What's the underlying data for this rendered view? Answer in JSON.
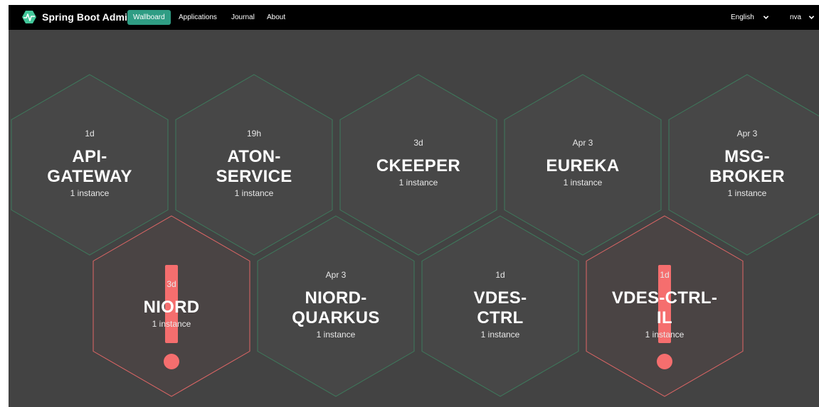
{
  "brand": {
    "title": "Spring Boot Admin"
  },
  "nav": {
    "items": [
      {
        "label": "Wallboard",
        "active": true
      },
      {
        "label": "Applications",
        "active": false
      },
      {
        "label": "Journal",
        "active": false
      },
      {
        "label": "About",
        "active": false
      }
    ],
    "language": "English",
    "user": "nva"
  },
  "colors": {
    "background": "#434343",
    "navbar": "#000000",
    "accent": "#2f9d84",
    "hex_up_border": "#3e7a5c",
    "hex_down_border": "#e06666",
    "hex_fill": "#474747",
    "down_indicator": "#f56e6e"
  },
  "applications": [
    {
      "time": "1d",
      "name_lines": [
        "API-",
        "GATEWAY"
      ],
      "instances": "1 instance",
      "status": "up"
    },
    {
      "time": "19h",
      "name_lines": [
        "ATON-",
        "SERVICE"
      ],
      "instances": "1 instance",
      "status": "up"
    },
    {
      "time": "3d",
      "name_lines": [
        "CKEEPER"
      ],
      "instances": "1 instance",
      "status": "up"
    },
    {
      "time": "Apr 3",
      "name_lines": [
        "EUREKA"
      ],
      "instances": "1 instance",
      "status": "up"
    },
    {
      "time": "Apr 3",
      "name_lines": [
        "MSG-",
        "BROKER"
      ],
      "instances": "1 instance",
      "status": "up"
    },
    {
      "time": "3d",
      "name_lines": [
        "NIORD"
      ],
      "instances": "1 instance",
      "status": "down"
    },
    {
      "time": "Apr 3",
      "name_lines": [
        "NIORD-",
        "QUARKUS"
      ],
      "instances": "1 instance",
      "status": "up"
    },
    {
      "time": "1d",
      "name_lines": [
        "VDES-",
        "CTRL"
      ],
      "instances": "1 instance",
      "status": "up"
    },
    {
      "time": "1d",
      "name_lines": [
        "VDES-CTRL-",
        "IL"
      ],
      "instances": "1 instance",
      "status": "down"
    }
  ]
}
